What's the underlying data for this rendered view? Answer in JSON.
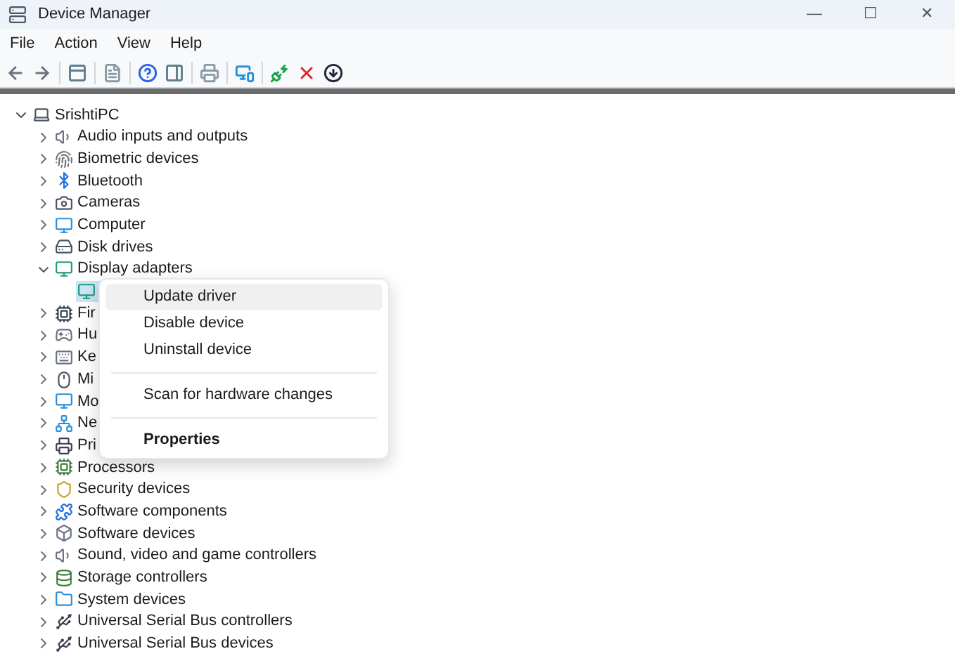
{
  "window": {
    "title": "Device Manager",
    "controls": [
      "—",
      "☐",
      "✕"
    ]
  },
  "menu": [
    "File",
    "Action",
    "View",
    "Help"
  ],
  "tree": {
    "label": "SrishtiPC",
    "expanded": true,
    "children": [
      {
        "label": "Audio inputs and outputs",
        "expanded": false
      },
      {
        "label": "Biometric devices",
        "expanded": false
      },
      {
        "label": "Bluetooth",
        "expanded": false
      },
      {
        "label": "Cameras",
        "expanded": false
      },
      {
        "label": "Computer",
        "expanded": false
      },
      {
        "label": "Disk drives",
        "expanded": false
      },
      {
        "label": "Display adapters",
        "expanded": true,
        "children": [
          {
            "selected": true
          }
        ]
      },
      {
        "label": "Fir",
        "expanded": false
      },
      {
        "label": "Hu",
        "expanded": false
      },
      {
        "label": "Ke",
        "expanded": false
      },
      {
        "label": "Mi",
        "expanded": false
      },
      {
        "label": "Mo",
        "expanded": false
      },
      {
        "label": "Ne",
        "expanded": false
      },
      {
        "label": "Pri",
        "expanded": false
      },
      {
        "label": "Processors",
        "expanded": false
      },
      {
        "label": "Security devices",
        "expanded": false
      },
      {
        "label": "Software components",
        "expanded": false
      },
      {
        "label": "Software devices",
        "expanded": false
      },
      {
        "label": "Sound, video and game controllers",
        "expanded": false
      },
      {
        "label": "Storage controllers",
        "expanded": false
      },
      {
        "label": "System devices",
        "expanded": false
      },
      {
        "label": "Universal Serial Bus controllers",
        "expanded": false
      },
      {
        "label": "Universal Serial Bus devices",
        "expanded": false
      }
    ]
  },
  "context_menu": [
    {
      "kind": "item",
      "label": "Update driver",
      "selected": true
    },
    {
      "kind": "item",
      "label": "Disable device",
      "selected": false
    },
    {
      "kind": "item",
      "label": "Uninstall device",
      "selected": false
    },
    {
      "kind": "separator"
    },
    {
      "kind": "item",
      "label": "Scan for hardware changes",
      "selected": false
    },
    {
      "kind": "separator"
    },
    {
      "kind": "default",
      "label": "Properties",
      "selected": false
    }
  ]
}
